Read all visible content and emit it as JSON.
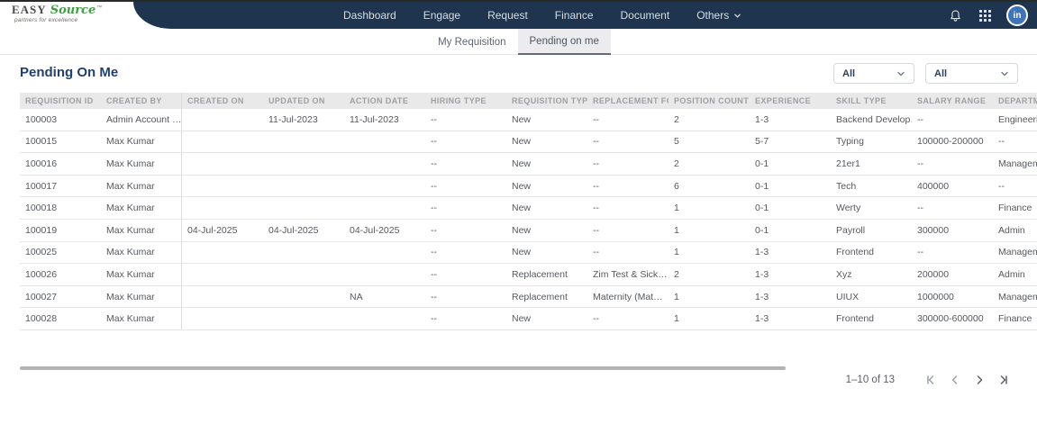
{
  "brand": {
    "primary": "EASY",
    "secondary": "Source",
    "trademark": "™",
    "tagline": "partners for excellence"
  },
  "nav": {
    "items": [
      {
        "label": "Dashboard"
      },
      {
        "label": "Engage"
      },
      {
        "label": "Request"
      },
      {
        "label": "Finance"
      },
      {
        "label": "Document"
      },
      {
        "label": "Others",
        "has_dropdown": true
      }
    ],
    "linkedin_label": "in"
  },
  "tabs": {
    "items": [
      {
        "label": "My Requisition",
        "active": false
      },
      {
        "label": "Pending on me",
        "active": true
      }
    ]
  },
  "page": {
    "title": "Pending On Me"
  },
  "filters": {
    "filter_1": {
      "value": "All"
    },
    "filter_2": {
      "value": "All"
    }
  },
  "table": {
    "columns": [
      "REQUISITION ID",
      "CREATED BY",
      "CREATED ON",
      "UPDATED ON",
      "ACTION DATE",
      "HIRING TYPE",
      "REQUISITION TYPE",
      "REPLACEMENT FOR",
      "POSITION COUNT",
      "EXPERIENCE",
      "SKILL TYPE",
      "SALARY RANGE",
      "DEPARTMENT"
    ],
    "rows": [
      [
        "100003",
        "Admin Account …",
        "",
        "11-Jul-2023",
        "11-Jul-2023",
        "--",
        "New",
        "--",
        "2",
        "1-3",
        "Backend Develop…",
        "--",
        "Engineering"
      ],
      [
        "100015",
        "Max Kumar",
        "",
        "",
        "",
        "--",
        "New",
        "--",
        "5",
        "5-7",
        "Typing",
        "100000-200000",
        "--"
      ],
      [
        "100016",
        "Max Kumar",
        "",
        "",
        "",
        "--",
        "New",
        "--",
        "2",
        "0-1",
        "21er1",
        "--",
        "Management"
      ],
      [
        "100017",
        "Max Kumar",
        "",
        "",
        "",
        "--",
        "New",
        "--",
        "6",
        "0-1",
        "Tech",
        "400000",
        "--"
      ],
      [
        "100018",
        "Max Kumar",
        "",
        "",
        "",
        "--",
        "New",
        "--",
        "1",
        "0-1",
        "Werty",
        "--",
        "Finance"
      ],
      [
        "100019",
        "Max Kumar",
        "04-Jul-2025",
        "04-Jul-2025",
        "04-Jul-2025",
        "--",
        "New",
        "--",
        "1",
        "0-1",
        "Payroll",
        "300000",
        "Admin"
      ],
      [
        "100025",
        "Max Kumar",
        "",
        "",
        "",
        "--",
        "New",
        "--",
        "1",
        "1-3",
        "Frontend",
        "--",
        "Management"
      ],
      [
        "100026",
        "Max Kumar",
        "",
        "",
        "",
        "--",
        "Replacement",
        "Zim Test & Sick…",
        "2",
        "1-3",
        "Xyz",
        "200000",
        "Admin"
      ],
      [
        "100027",
        "Max Kumar",
        "",
        "",
        "NA",
        "--",
        "Replacement",
        "Maternity (Mat…",
        "1",
        "1-3",
        "UIUX",
        "1000000",
        "Management"
      ],
      [
        "100028",
        "Max Kumar",
        "",
        "",
        "",
        "--",
        "New",
        "--",
        "1",
        "1-3",
        "Frontend",
        "300000-600000",
        "Finance"
      ]
    ]
  },
  "pagination": {
    "range_label": "1–10 of 13"
  },
  "colors": {
    "navbar": "#1e344f",
    "brand_green": "#3f9e42",
    "linkedin_blue": "#3f74b9",
    "title_navy": "#23406b"
  }
}
